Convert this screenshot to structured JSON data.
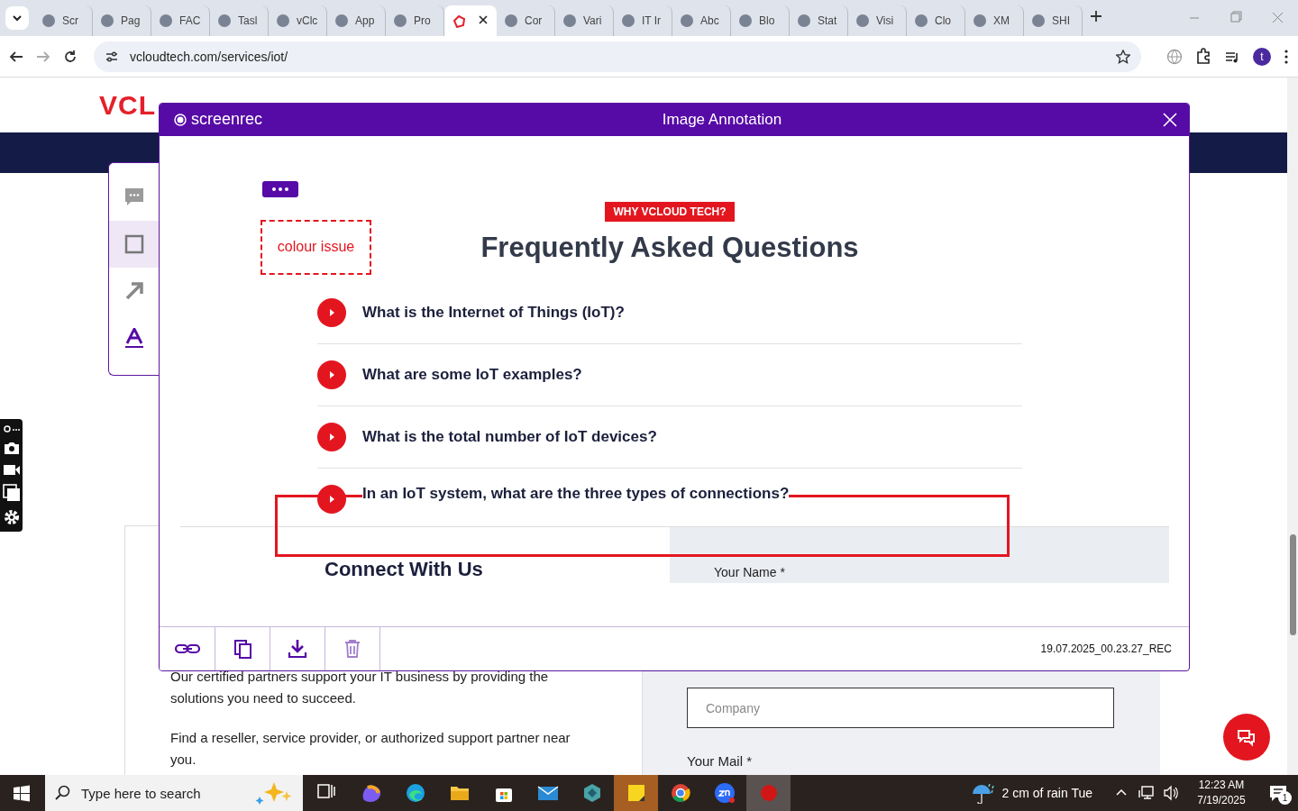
{
  "browser": {
    "tabs": [
      {
        "label": "Scr",
        "selected": false
      },
      {
        "label": "Pag",
        "selected": false
      },
      {
        "label": "FAC",
        "selected": false
      },
      {
        "label": "Tasl",
        "selected": false
      },
      {
        "label": "vClc",
        "selected": false
      },
      {
        "label": "App",
        "selected": false
      },
      {
        "label": "Pro",
        "selected": false
      },
      {
        "selected": true
      },
      {
        "label": "Cor",
        "selected": false
      },
      {
        "label": "Vari",
        "selected": false
      },
      {
        "label": "IT Ir",
        "selected": false
      },
      {
        "label": "Abc",
        "selected": false
      },
      {
        "label": "Blo",
        "selected": false
      },
      {
        "label": "Stat",
        "selected": false
      },
      {
        "label": "Visi",
        "selected": false
      },
      {
        "label": "Clo",
        "selected": false
      },
      {
        "label": "XM",
        "selected": false
      },
      {
        "label": "SHI",
        "selected": false
      }
    ],
    "address": "vcloudtech.com/services/iot/",
    "profile_initial": "t"
  },
  "site": {
    "logo": "VCL",
    "intro": "Our certified partners support your IT business by providing the solutions you need to succeed.",
    "partner_note": "Find a reseller, service provider, or authorized support partner near you.",
    "company_placeholder": "Company",
    "mail_label": "Your Mail *"
  },
  "annotator": {
    "brand": "screenrec",
    "title": "Image Annotation",
    "tools": [
      {
        "kind": "comment",
        "selected": false
      },
      {
        "kind": "rectangle",
        "selected": true
      },
      {
        "kind": "arrow",
        "selected": false
      },
      {
        "kind": "text",
        "selected": false
      }
    ],
    "image": {
      "note": "colour issue",
      "badge": "WHY VCLOUD TECH?",
      "heading": "Frequently Asked Questions",
      "faqs": [
        "What is the Internet of Things (IoT)?",
        "What are some IoT examples?",
        "What is the total number of IoT devices?",
        "In an IoT system, what are the three types of connections?"
      ],
      "section_title": "Connect With Us",
      "field_label": "Your Name *"
    },
    "actions": [
      {
        "kind": "link"
      },
      {
        "kind": "copy"
      },
      {
        "kind": "download"
      },
      {
        "kind": "delete"
      }
    ],
    "filename": "19.07.2025_00.23.27_REC"
  },
  "taskbar": {
    "search_placeholder": "Type here to search",
    "weather": "2 cm of rain Tue",
    "time": "12:23 AM",
    "date": "7/19/2025",
    "notifications": "1"
  }
}
